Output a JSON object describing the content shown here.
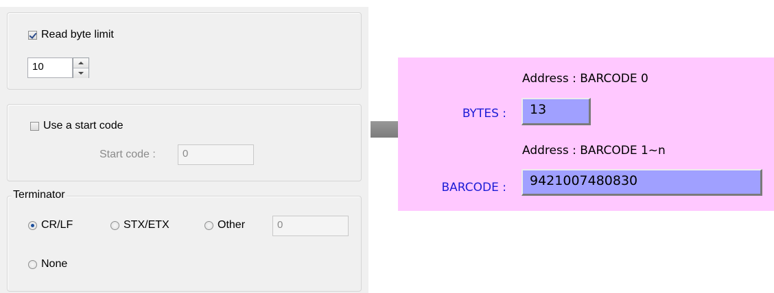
{
  "settings": {
    "read_byte_limit": {
      "label": "Read byte limit",
      "checked": true,
      "value": "10"
    },
    "start_code": {
      "label": "Use a start code",
      "checked": false,
      "field_label": "Start code :",
      "value": "0"
    },
    "terminator": {
      "title": "Terminator",
      "options": [
        "CR/LF",
        "STX/ETX",
        "Other",
        "None"
      ],
      "selected": "CR/LF",
      "other_value": "0"
    }
  },
  "display": {
    "bytes_address": "Address : BARCODE 0",
    "bytes_label": "BYTES :",
    "bytes_value": "13",
    "barcode_address": "Address : BARCODE 1~n",
    "barcode_label": "BARCODE :",
    "barcode_value": "9421007480830"
  },
  "colors": {
    "panel_bg": "#ffc8ff",
    "value_box": "#a0a0ff",
    "label_blue": "#1b1bd6"
  }
}
